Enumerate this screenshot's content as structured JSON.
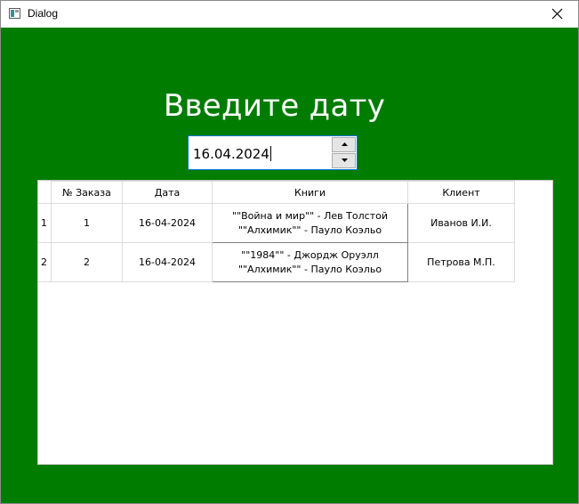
{
  "window": {
    "title": "Dialog",
    "icons": {
      "app": "app-window-icon",
      "close": "close-icon"
    }
  },
  "main": {
    "heading": "Введите дату",
    "date_input": {
      "value": "16.04.2024"
    },
    "spin_icons": {
      "up": "spin-up-arrow-icon",
      "down": "spin-down-arrow-icon"
    }
  },
  "table": {
    "columns": [
      "№ Заказа",
      "Дата",
      "Книги",
      "Клиент"
    ],
    "rows": [
      {
        "header": "1",
        "order": "1",
        "date": "16-04-2024",
        "books": [
          "\"\"Война и мир\"\" - Лев Толстой",
          "\"\"Алхимик\"\" - Пауло Коэльо"
        ],
        "client": "Иванов И.И."
      },
      {
        "header": "2",
        "order": "2",
        "date": "16-04-2024",
        "books": [
          "\"\"1984\"\" - Джордж Оруэлл",
          "\"\"Алхимик\"\" - Пауло Коэльо"
        ],
        "client": "Петрова М.П."
      }
    ]
  },
  "colors": {
    "background": "#007c00",
    "heading_text": "#ffffff",
    "focus_border": "#0078d7"
  }
}
